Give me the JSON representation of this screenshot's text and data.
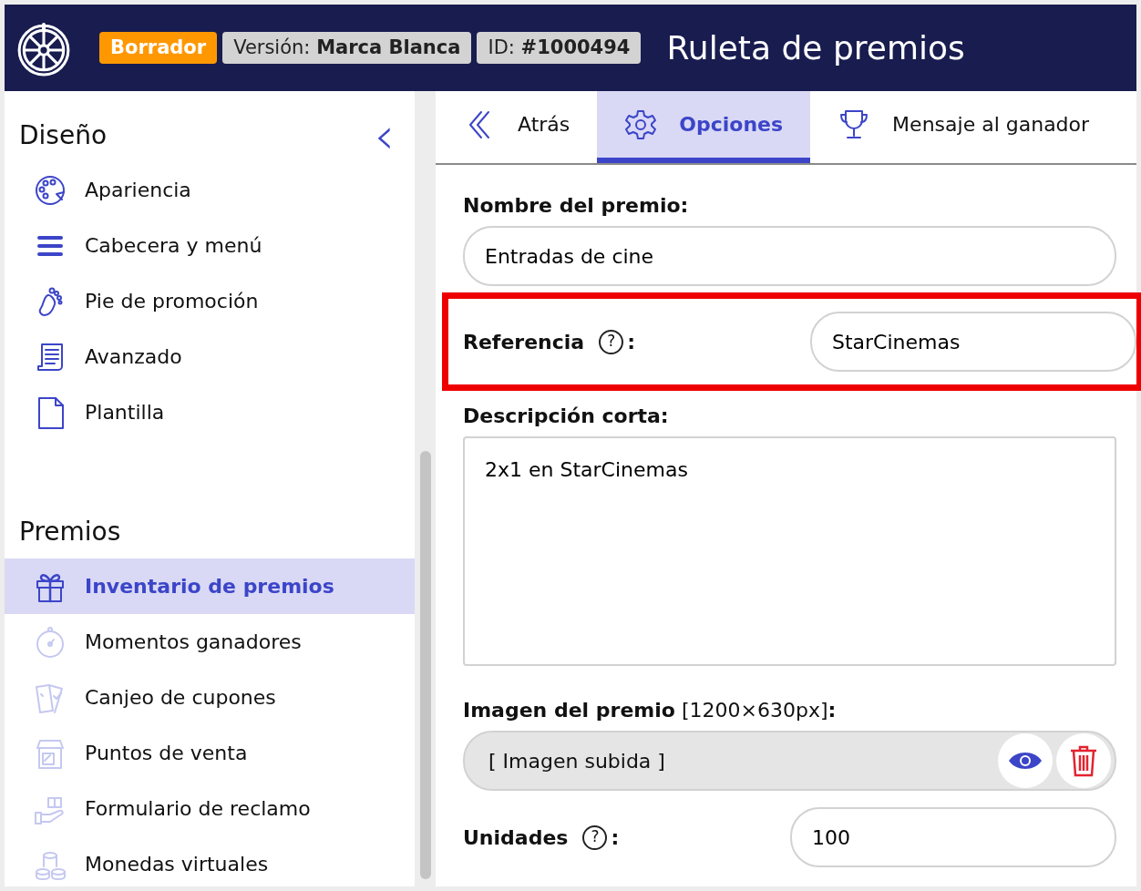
{
  "header": {
    "status_badge": "Borrador",
    "version_label": "Versión:",
    "version_value": "Marca Blanca",
    "id_label": "ID:",
    "id_value": "#1000494",
    "title": "Ruleta de premios"
  },
  "sidebar": {
    "sections": [
      {
        "title": "Diseño",
        "collapse": "‹",
        "items": [
          {
            "label": "Apariencia",
            "selected": false,
            "faded": false
          },
          {
            "label": "Cabecera y menú",
            "selected": false,
            "faded": false
          },
          {
            "label": "Pie de promoción",
            "selected": false,
            "faded": false
          },
          {
            "label": "Avanzado",
            "selected": false,
            "faded": false
          },
          {
            "label": "Plantilla",
            "selected": false,
            "faded": false
          }
        ]
      },
      {
        "title": "Premios",
        "items": [
          {
            "label": "Inventario de premios",
            "selected": true,
            "faded": false
          },
          {
            "label": "Momentos ganadores",
            "selected": false,
            "faded": true
          },
          {
            "label": "Canjeo de cupones",
            "selected": false,
            "faded": true
          },
          {
            "label": "Puntos de venta",
            "selected": false,
            "faded": true
          },
          {
            "label": "Formulario de reclamo",
            "selected": false,
            "faded": true
          },
          {
            "label": "Monedas virtuales",
            "selected": false,
            "faded": true
          }
        ]
      }
    ]
  },
  "tabs": [
    {
      "label": "Atrás",
      "selected": false
    },
    {
      "label": "Opciones",
      "selected": true
    },
    {
      "label": "Mensaje al ganador",
      "selected": false
    }
  ],
  "form": [
    {
      "kind": "text",
      "label": "Nombre del premio:",
      "value": "Entradas de cine"
    },
    {
      "kind": "inline",
      "label": "Referencia",
      "help": "?",
      "colon": ":",
      "value": "StarCinemas",
      "highlighted": true
    },
    {
      "kind": "textarea",
      "label": "Descripción corta:",
      "value": "2x1 en StarCinemas"
    },
    {
      "kind": "image",
      "label": "**Imagen del premio** [1200×630px]**:**",
      "value": "[ Imagen subida ]"
    },
    {
      "kind": "inline",
      "label": "Unidades",
      "help": "?",
      "colon": ":",
      "value": "100",
      "highlighted": false
    }
  ]
}
